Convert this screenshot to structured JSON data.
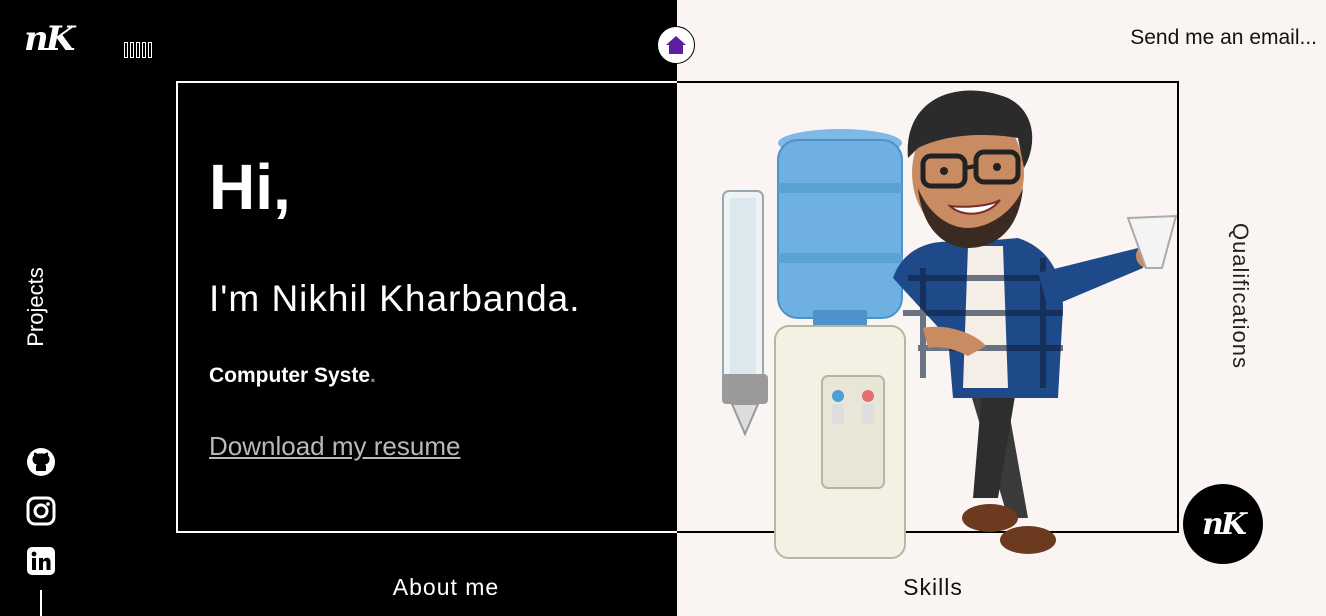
{
  "brand": {
    "logo_text": "nK"
  },
  "nav": {
    "email_label": "Send me an email...",
    "projects_label": "Projects",
    "qualifications_label": "Qualifications",
    "about_label": "About me",
    "skills_label": "Skills"
  },
  "hero": {
    "greeting": "Hi,",
    "intro": "I'm Nikhil Kharbanda.",
    "role_typed": "Computer Syste",
    "role_cursor": ".",
    "resume_link": "Download my resume"
  },
  "badge": {
    "text": "nK"
  },
  "icons": {
    "menu": "menu-icon",
    "home": "home-icon",
    "github": "github-icon",
    "instagram": "instagram-icon",
    "linkedin": "linkedin-icon"
  },
  "colors": {
    "left_bg": "#000000",
    "right_bg": "#faf5f2",
    "home_accent": "#5b1fa3",
    "link_muted": "#b9b9b9"
  }
}
